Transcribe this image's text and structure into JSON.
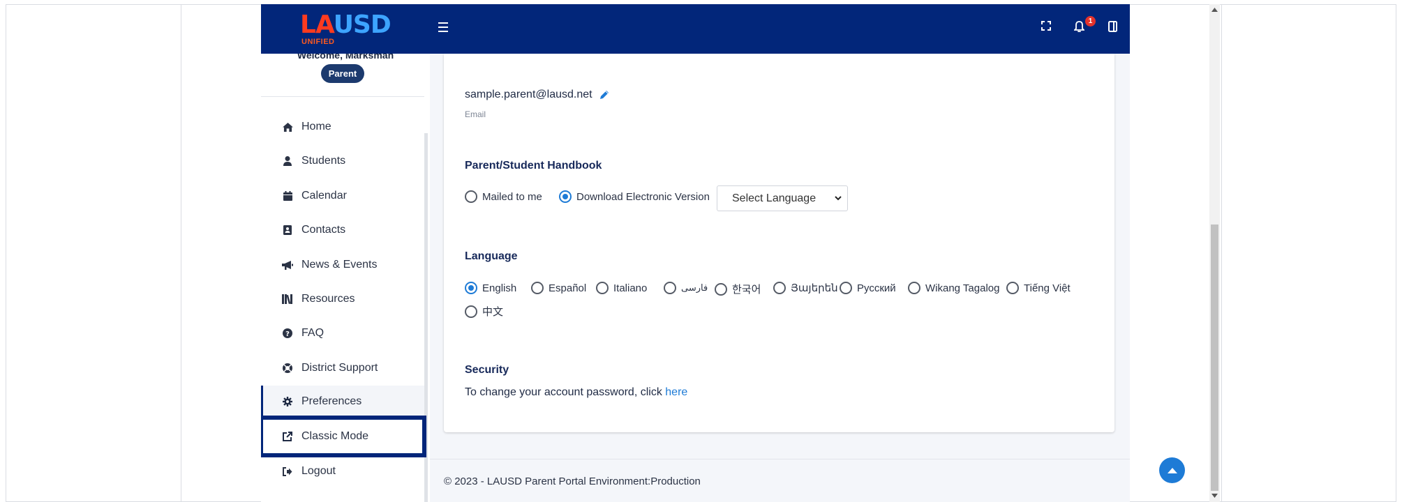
{
  "header": {
    "logo": {
      "part1": "LA",
      "part2": "USD",
      "sub": "UNIFIED"
    },
    "icons": [
      "menu-icon",
      "fullscreen-icon",
      "bell-icon",
      "panel-icon"
    ],
    "notification_count": "1",
    "colors": {
      "bar": "#02267a",
      "accent_red": "#ff3b1f",
      "accent_blue": "#3da4ff"
    }
  },
  "sidebar": {
    "welcome": "Welcome, Marksman",
    "role": "Parent",
    "items": [
      {
        "label": "Home",
        "icon": "home-icon"
      },
      {
        "label": "Students",
        "icon": "user-icon"
      },
      {
        "label": "Calendar",
        "icon": "calendar-icon"
      },
      {
        "label": "Contacts",
        "icon": "contact-card-icon"
      },
      {
        "label": "News & Events",
        "icon": "megaphone-icon"
      },
      {
        "label": "Resources",
        "icon": "books-icon"
      },
      {
        "label": "FAQ",
        "icon": "question-icon"
      },
      {
        "label": "District Support",
        "icon": "lifebuoy-icon"
      },
      {
        "label": "Preferences",
        "icon": "gear-icon"
      },
      {
        "label": "Classic Mode",
        "icon": "external-link-icon"
      },
      {
        "label": "Logout",
        "icon": "logout-icon"
      }
    ]
  },
  "main": {
    "email": {
      "value": "sample.parent@lausd.net",
      "label": "Email"
    },
    "handbook": {
      "title": "Parent/Student Handbook",
      "options": [
        {
          "label": "Mailed to me",
          "selected": false
        },
        {
          "label": "Download Electronic Version",
          "selected": true
        }
      ],
      "language_select": {
        "selected": "Select Language"
      }
    },
    "language": {
      "title": "Language",
      "options": [
        {
          "label": "English",
          "selected": true
        },
        {
          "label": "Español",
          "selected": false
        },
        {
          "label": "Italiano",
          "selected": false
        },
        {
          "label": "فارسی",
          "selected": false
        },
        {
          "label": "한국어",
          "selected": false
        },
        {
          "label": "Յայերեն",
          "selected": false
        },
        {
          "label": "Русский",
          "selected": false
        },
        {
          "label": "Wikang Tagalog",
          "selected": false
        },
        {
          "label": "Tiếng Việt",
          "selected": false
        },
        {
          "label": "中文",
          "selected": false
        }
      ]
    },
    "security": {
      "title": "Security",
      "text": "To change your account password, click ",
      "link": "here"
    }
  },
  "footer": {
    "text": "© 2023 - LAUSD Parent Portal Environment:Production"
  }
}
